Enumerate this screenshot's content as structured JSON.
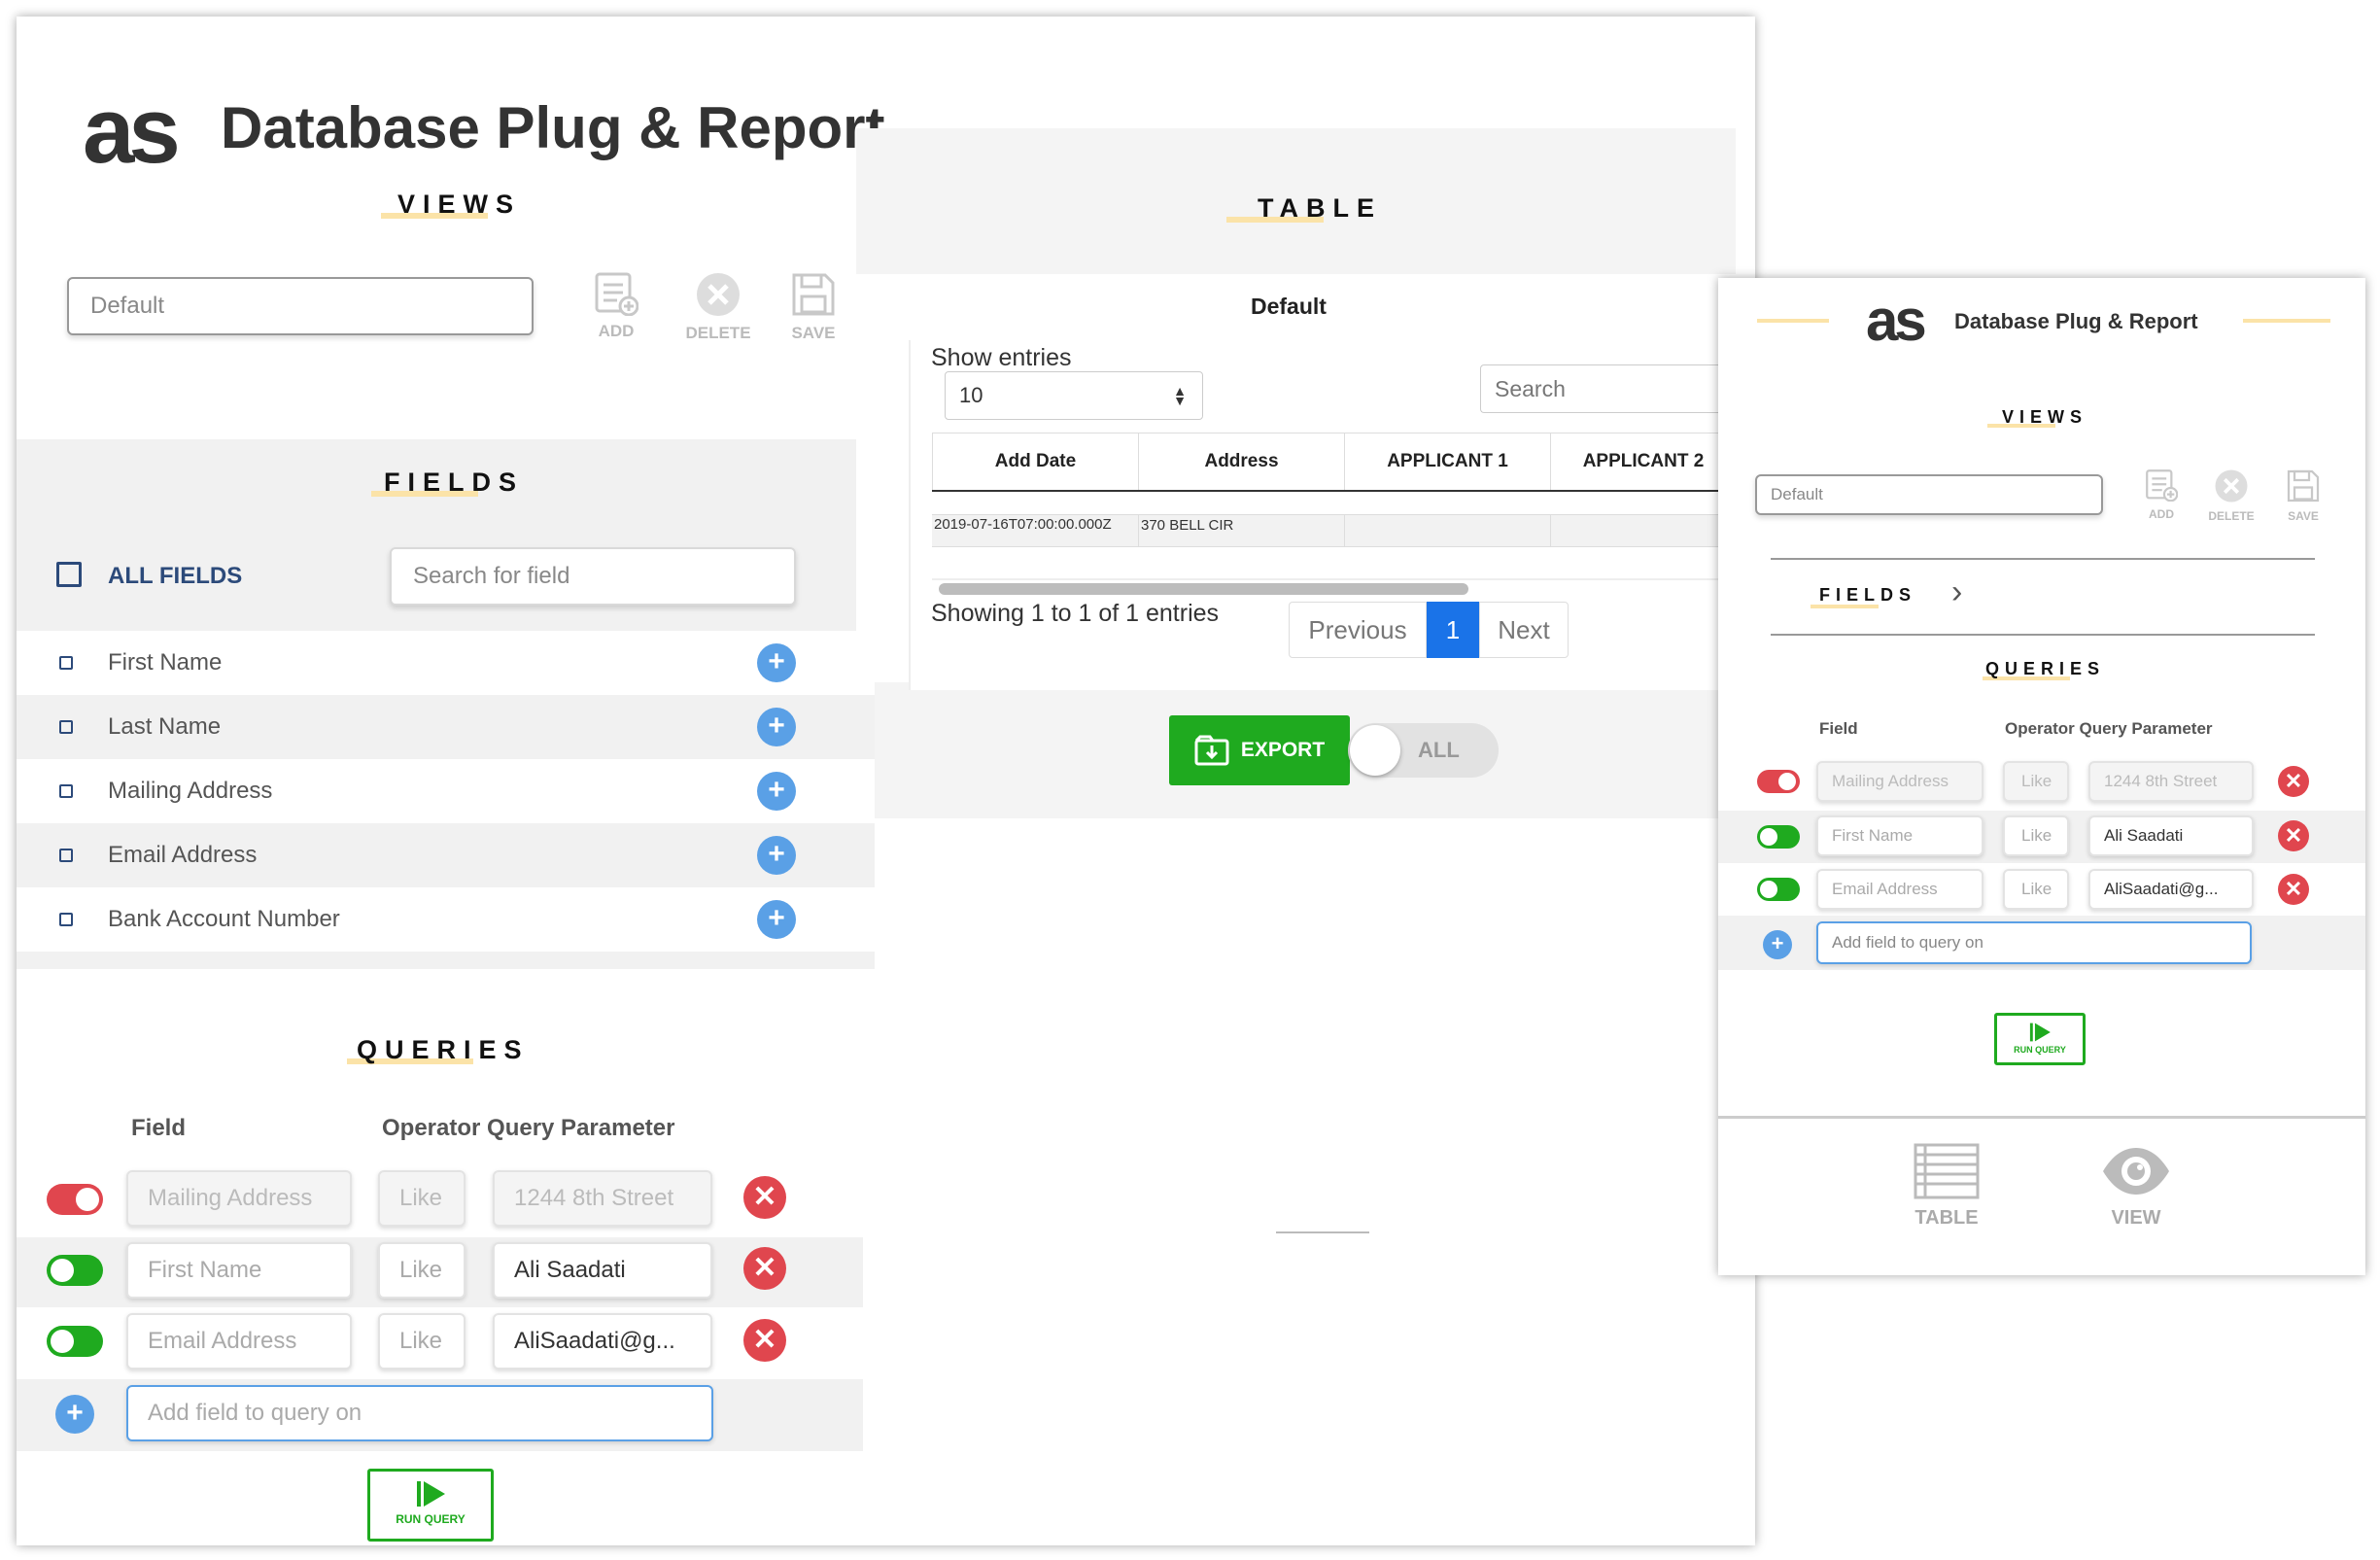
{
  "app": {
    "title": "Database Plug & Report",
    "logo_text": "as"
  },
  "views": {
    "heading": "VIEWS",
    "current_view": "Default",
    "add_label": "ADD",
    "delete_label": "DELETE",
    "save_label": "SAVE"
  },
  "fields": {
    "heading": "FIELDS",
    "all_fields_label": "ALL FIELDS",
    "search_placeholder": "Search for field",
    "items": [
      {
        "label": "First Name"
      },
      {
        "label": "Last Name"
      },
      {
        "label": "Mailing Address"
      },
      {
        "label": "Email Address"
      },
      {
        "label": "Bank Account Number"
      }
    ]
  },
  "queries": {
    "heading": "QUERIES",
    "col_field": "Field",
    "col_operator_param": "Operator Query Parameter",
    "rows": [
      {
        "enabled": false,
        "field": "Mailing Address",
        "operator": "Like",
        "parameter": "1244 8th Street"
      },
      {
        "enabled": true,
        "field": "First Name",
        "operator": "Like",
        "parameter": "Ali Saadati"
      },
      {
        "enabled": true,
        "field": "Email Address",
        "operator": "Like",
        "parameter": "AliSaadati@g..."
      }
    ],
    "add_placeholder": "Add field to query on",
    "run_label": "RUN QUERY"
  },
  "table": {
    "heading": "TABLE",
    "view_name": "Default",
    "show_entries_label": "Show entries",
    "entries_value": "10",
    "search_placeholder": "Search",
    "columns": [
      "Add Date",
      "Address",
      "APPLICANT 1",
      "APPLICANT 2"
    ],
    "rows": [
      [
        "2019-07-16T07:00:00.000Z",
        "370 BELL CIR",
        "",
        ""
      ]
    ],
    "info": "Showing 1 to 1 of 1 entries",
    "prev_label": "Previous",
    "page": "1",
    "next_label": "Next",
    "export_label": "EXPORT",
    "toggle_label": "ALL"
  },
  "mobile": {
    "title": "Database Plug & Report",
    "views_heading": "VIEWS",
    "current_view": "Default",
    "add_label": "ADD",
    "delete_label": "DELETE",
    "save_label": "SAVE",
    "fields_heading": "FIELDS",
    "queries_heading": "QUERIES",
    "col_field": "Field",
    "col_operator_param": "Operator Query Parameter",
    "add_placeholder": "Add field to query on",
    "run_label": "RUN QUERY",
    "nav_table": "TABLE",
    "nav_view": "VIEW"
  },
  "colors": {
    "accent_underline": "#fbe3a8",
    "primary": "#1a73e8",
    "green": "#1faa1f",
    "red": "#e0464e",
    "blue_plus": "#5aa0e6"
  }
}
